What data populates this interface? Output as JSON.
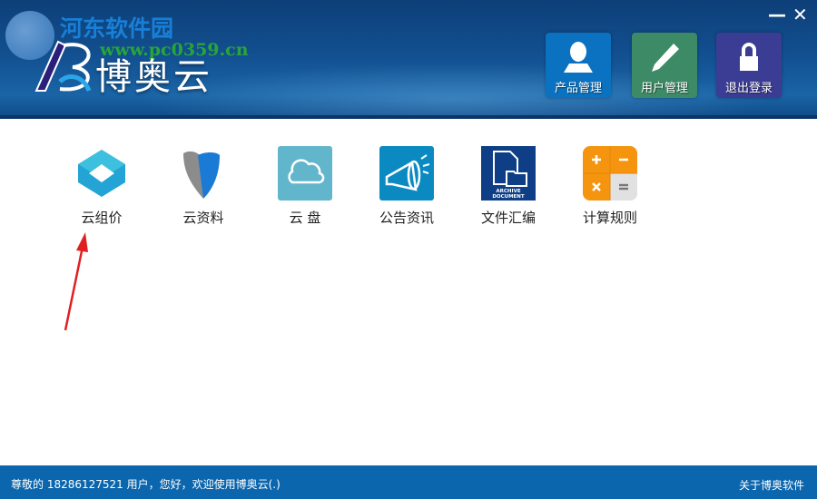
{
  "header": {
    "watermark_text": "河东软件园",
    "watermark_url": "www.pc0359.cn",
    "app_title": "博奥云",
    "minimize": "—",
    "close": "✕",
    "buttons": [
      {
        "label": "产品管理",
        "icon": "user-icon",
        "color": "#0a72c0"
      },
      {
        "label": "用户管理",
        "icon": "pencil-icon",
        "color": "#3d8a66"
      },
      {
        "label": "退出登录",
        "icon": "lock-icon",
        "color": "#3b3c93"
      }
    ]
  },
  "apps": [
    {
      "label": "云组价",
      "icon": "cube-icon"
    },
    {
      "label": "云资料",
      "icon": "shield-icon"
    },
    {
      "label": "云 盘",
      "icon": "cloud-icon"
    },
    {
      "label": "公告资讯",
      "icon": "megaphone-icon"
    },
    {
      "label": "文件汇编",
      "icon": "archive-icon",
      "icon_text": [
        "ARCHIVE",
        "DOCUMENT"
      ]
    },
    {
      "label": "计算规则",
      "icon": "calculator-icon"
    }
  ],
  "status": {
    "message": "尊敬的 18286127521 用户，您好，欢迎使用博奥云(.)",
    "about": "关于博奥软件"
  }
}
